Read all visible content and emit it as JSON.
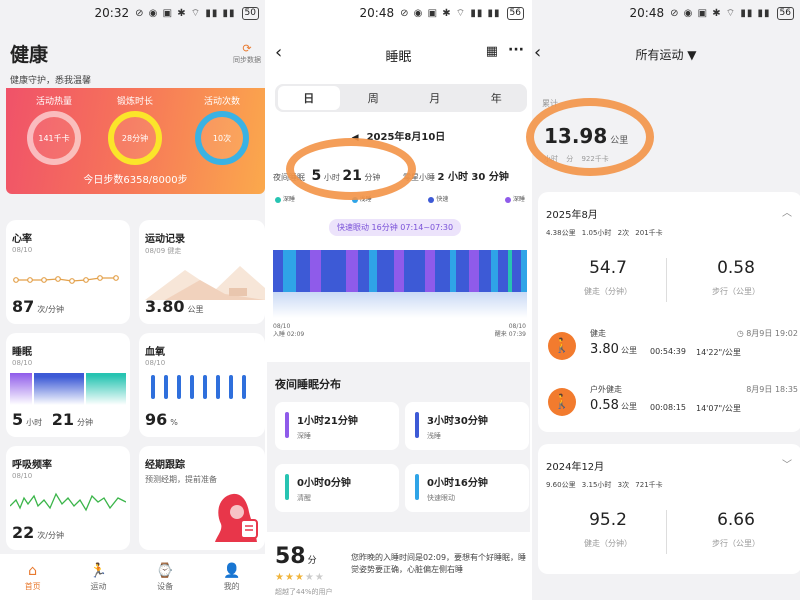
{
  "status": {
    "p1_time": "20:32",
    "p1_batt": "50",
    "p2_time": "20:48",
    "p2_batt": "56",
    "p3_time": "20:48",
    "p3_batt": "56",
    "icons": "⊘ ◉ ▣ ✱ ⌔ ▮▮ ▮▮"
  },
  "health": {
    "title": "健康",
    "subtitle": "健康守护，悉我温馨",
    "sync_label": "同步数据",
    "rings": [
      {
        "label": "活动热量",
        "value": "141千卡"
      },
      {
        "label": "锻炼时长",
        "value": "28分钟"
      },
      {
        "label": "活动次数",
        "value": "10次"
      }
    ],
    "steps": "今日步数6358/8000步",
    "cards": {
      "heart": {
        "title": "心率",
        "date": "08/10",
        "value": "87",
        "unit": "次/分钟"
      },
      "exercise": {
        "title": "运动记录",
        "date": "08/09 健走",
        "value": "3.80",
        "unit": "公里"
      },
      "sleep": {
        "title": "睡眠",
        "date": "08/10",
        "h": "5",
        "h_unit": "小时",
        "m": "21",
        "m_unit": "分钟"
      },
      "spo2": {
        "title": "血氧",
        "date": "08/10",
        "value": "96",
        "unit": "%"
      },
      "resp": {
        "title": "呼吸频率",
        "date": "08/10",
        "value": "22",
        "unit": "次/分钟"
      },
      "period": {
        "title": "经期跟踪",
        "desc": "预测经期，提前准备"
      }
    },
    "tabs": [
      {
        "label": "首页",
        "icon": "⌂"
      },
      {
        "label": "运动",
        "icon": "🏃"
      },
      {
        "label": "设备",
        "icon": "⌚"
      },
      {
        "label": "我的",
        "icon": "👤"
      }
    ]
  },
  "sleep": {
    "title": "睡眠",
    "tabs": [
      "日",
      "周",
      "月",
      "年"
    ],
    "date": "2025年8月10日",
    "night_label": "夜间睡眠",
    "night_h": "5",
    "night_h_unit": "小时",
    "night_m": "21",
    "night_m_unit": "分钟",
    "nap_label": "零星小睡",
    "nap_value": "2 小时 30 分钟",
    "legend": [
      "深睡",
      "浅睡",
      "快速",
      "深睡"
    ],
    "rem_pill": "快速眼动 16分钟 07:14~07:30",
    "axis_left": [
      "08/10",
      "入睡 02:09"
    ],
    "axis_right": [
      "08/10",
      "醒来 07:39"
    ],
    "dist_title": "夜间睡眠分布",
    "stats": [
      {
        "value": "1小时21分钟",
        "label": "深睡",
        "color": "#8f5bea"
      },
      {
        "value": "3小时30分钟",
        "label": "浅睡",
        "color": "#3d5ad6"
      },
      {
        "value": "0小时0分钟",
        "label": "清醒",
        "color": "#27c4b2"
      },
      {
        "value": "0小时16分钟",
        "label": "快速眼动",
        "color": "#2fa4e7"
      }
    ],
    "score": "58",
    "score_unit": "分",
    "score_cut": "超越了44%的用户",
    "score_text": "您昨晚的入睡时间是02:09，要想有个好睡眠，睡觉姿势要正确，心脏偏左侧右睡",
    "colors": {
      "deep": "#8f5bea",
      "light": "#3d5ad6",
      "awake": "#27c4b2",
      "rem": "#2fa4e7"
    }
  },
  "sport": {
    "title": "所有运动 ▼",
    "total_cut": "累计",
    "total_km": "13.98",
    "total_unit": "公里",
    "total_sub": "小时 分 922千卡",
    "months": [
      {
        "title": "2025年8月",
        "summary": "4.38公里 1.05小时 2次 201千卡",
        "walk": "54.7",
        "walk_label": "健走（分钟）",
        "run": "0.58",
        "run_label": "步行（公里）",
        "activities": [
          {
            "name": "健走",
            "dist": "3.80",
            "unit": "公里",
            "dur": "00:54:39",
            "pace": "14'22\"/公里",
            "when": "◷ 8月9日 19:02",
            "icon": "🚶"
          },
          {
            "name": "户外健走",
            "dist": "0.58",
            "unit": "公里",
            "dur": "00:08:15",
            "pace": "14'07\"/公里",
            "when": "8月9日 18:35",
            "icon": "🚶"
          }
        ]
      },
      {
        "title": "2024年12月",
        "summary": "9.60公里 3.15小时 3次 721千卡",
        "walk": "95.2",
        "walk_label": "健走（分钟）",
        "run": "6.66",
        "run_label": "步行（公里）"
      }
    ]
  }
}
